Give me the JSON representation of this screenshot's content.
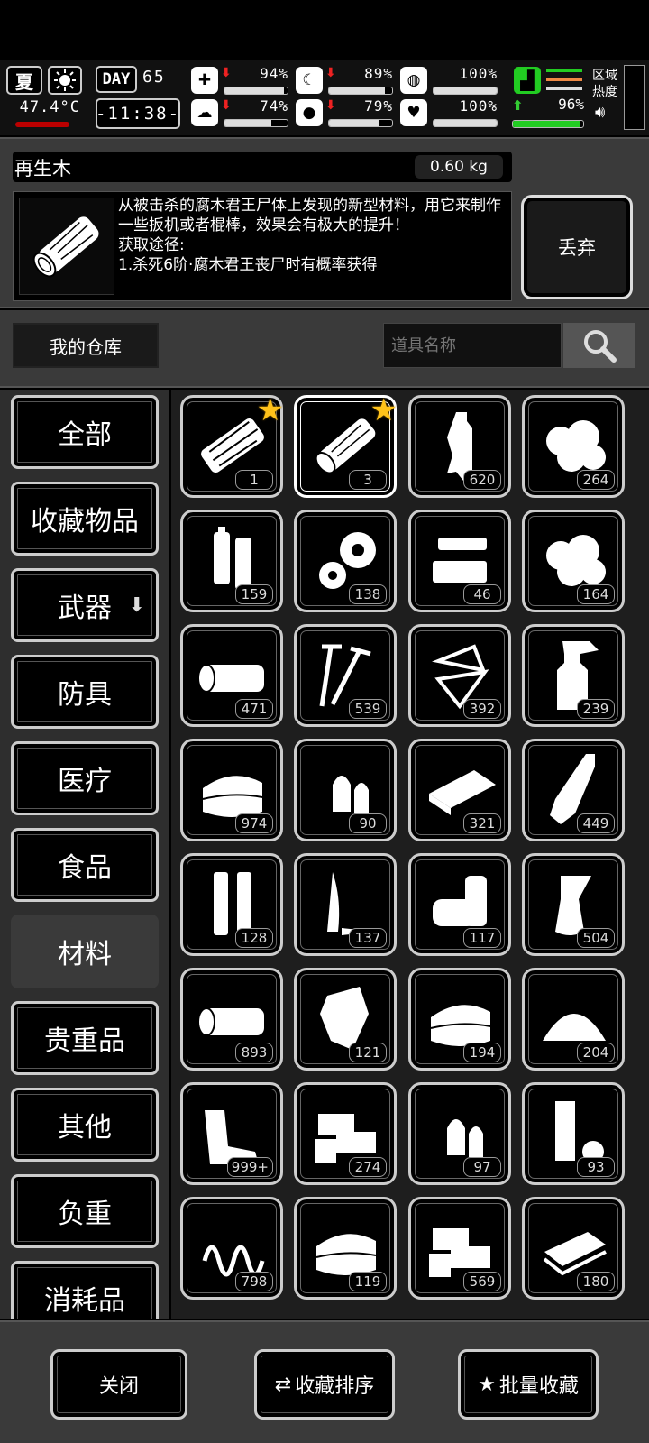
{
  "status": {
    "season": "夏",
    "temperature": "47.4°C",
    "day_label": "DAY",
    "day_number": "65",
    "clock": "-11:38-",
    "stats": [
      {
        "name": "health",
        "icon": "medkit-icon",
        "glyph": "✚",
        "trend": "down",
        "value": "94%",
        "level": 0.94
      },
      {
        "name": "hunger",
        "icon": "stomach-icon",
        "glyph": "☾",
        "trend": "down",
        "value": "89%",
        "level": 0.89
      },
      {
        "name": "stamina",
        "icon": "lung-icon",
        "glyph": "◍",
        "trend": "none",
        "value": "100%",
        "level": 1.0
      },
      {
        "name": "mood",
        "icon": "brain-icon",
        "glyph": "☁",
        "trend": "down",
        "value": "74%",
        "level": 0.74
      },
      {
        "name": "thirst",
        "icon": "water-drop-icon",
        "glyph": "💧",
        "trend": "down",
        "value": "79%",
        "level": 0.79
      },
      {
        "name": "heart",
        "icon": "heart-icon",
        "glyph": "♥",
        "trend": "none",
        "value": "100%",
        "level": 1.0
      },
      {
        "name": "weight-capacity",
        "icon": "boot-icon",
        "glyph": "▟",
        "trend": "up",
        "value": "96%",
        "level": 0.96
      }
    ],
    "area_heat_label": "区域\n热度"
  },
  "item": {
    "name": "再生木",
    "weight": "0.60 kg",
    "description": "从被击杀的腐木君王尸体上发现的新型材料，用它来制作一些扳机或者棍棒，效果会有极大的提升！\n获取途径:\n1.杀死6阶·腐木君王丧尸时有概率获得",
    "discard_label": "丢弃"
  },
  "warehouse": {
    "label": "我的仓库",
    "search_placeholder": "道具名称"
  },
  "categories": [
    {
      "label": "全部",
      "active": false
    },
    {
      "label": "收藏物品",
      "active": false
    },
    {
      "label": "武器",
      "active": false,
      "has_submenu": true
    },
    {
      "label": "防具",
      "active": false
    },
    {
      "label": "医疗",
      "active": false
    },
    {
      "label": "食品",
      "active": false
    },
    {
      "label": "材料",
      "active": true
    },
    {
      "label": "贵重品",
      "active": false
    },
    {
      "label": "其他",
      "active": false
    },
    {
      "label": "负重",
      "active": false
    },
    {
      "label": "消耗品",
      "active": false
    }
  ],
  "items": [
    {
      "icon": "broken-wood-icon",
      "count": "1",
      "starred": true
    },
    {
      "icon": "regen-wood-icon",
      "count": "3",
      "starred": true,
      "selected": true
    },
    {
      "icon": "plastic-bottle-icon",
      "count": "620"
    },
    {
      "icon": "cotton-icon",
      "count": "264"
    },
    {
      "icon": "battery-icon",
      "count": "159"
    },
    {
      "icon": "gears-icon",
      "count": "138"
    },
    {
      "icon": "parts-icon",
      "count": "46"
    },
    {
      "icon": "cotton-balls-icon",
      "count": "164"
    },
    {
      "icon": "log-icon",
      "count": "471"
    },
    {
      "icon": "screws-icon",
      "count": "539"
    },
    {
      "icon": "glass-shards-icon",
      "count": "392"
    },
    {
      "icon": "spray-bottle-icon",
      "count": "239"
    },
    {
      "icon": "cloth-stack-icon",
      "count": "974"
    },
    {
      "icon": "bullet-heads-icon",
      "count": "90"
    },
    {
      "icon": "metal-plate-icon",
      "count": "321"
    },
    {
      "icon": "glass-bottle-icon",
      "count": "449"
    },
    {
      "icon": "shell-casings-icon",
      "count": "128"
    },
    {
      "icon": "knife-blade-icon",
      "count": "137"
    },
    {
      "icon": "pipes-icon",
      "count": "117"
    },
    {
      "icon": "glue-tube-icon",
      "count": "504"
    },
    {
      "icon": "wood-pile-icon",
      "count": "893"
    },
    {
      "icon": "scrap-metal-icon",
      "count": "121"
    },
    {
      "icon": "fabric-icon",
      "count": "194"
    },
    {
      "icon": "powder-pile-icon",
      "count": "204"
    },
    {
      "icon": "rubber-pieces-icon",
      "count": "999+"
    },
    {
      "icon": "wood-blocks-icon",
      "count": "274"
    },
    {
      "icon": "bullet-icon",
      "count": "97"
    },
    {
      "icon": "tape-roll-icon",
      "count": "93"
    },
    {
      "icon": "spring-icon",
      "count": "798"
    },
    {
      "icon": "leather-icon",
      "count": "119"
    },
    {
      "icon": "planks-icon",
      "count": "569"
    },
    {
      "icon": "whetstone-icon",
      "count": "180"
    }
  ],
  "footer": {
    "close_label": "关闭",
    "sort_label": "收藏排序",
    "batch_label": "批量收藏"
  }
}
